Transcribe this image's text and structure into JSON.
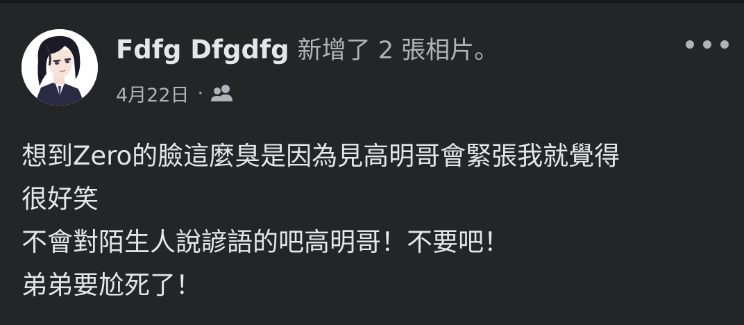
{
  "post": {
    "author": "Fdfg Dfgdfg",
    "action": "新增了 2 張相片。",
    "date": "4月22日",
    "separator": "·",
    "audience_icon": "friends-icon",
    "more_icon": "more-horizontal-icon",
    "body_lines": [
      "想到Zero的臉這麼臭是因為見高明哥會緊張我就覺得",
      "很好笑",
      "不會對陌生人說諺語的吧高明哥！不要吧！",
      "弟弟要尬死了！"
    ]
  },
  "colors": {
    "background": "#242526",
    "primary_text": "#e4e6eb",
    "secondary_text": "#b0b3b8"
  }
}
